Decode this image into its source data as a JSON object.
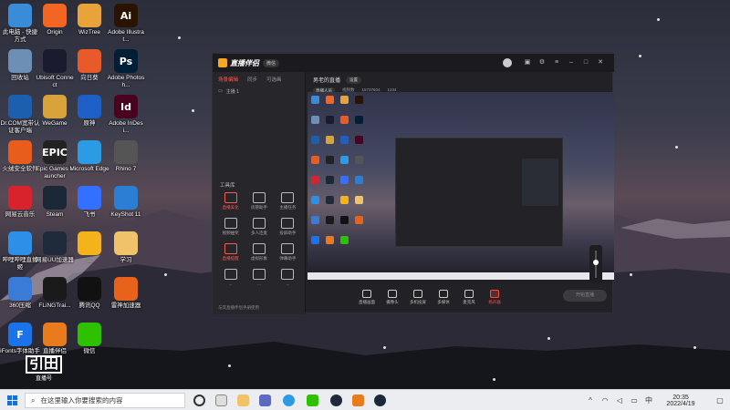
{
  "desktop": {
    "icons": [
      {
        "label": "此电脑 - 快捷方式",
        "color": "#3a8bd8",
        "icon": "computer-icon"
      },
      {
        "label": "Origin",
        "color": "#f26522",
        "icon": "origin-icon"
      },
      {
        "label": "WizTree",
        "color": "#e8a33b",
        "icon": "wiztree-icon"
      },
      {
        "label": "Adobe Illustrat...",
        "color": "#2a1300",
        "icon": "illustrator-icon",
        "glyph": "Ai"
      },
      {
        "label": "回收站",
        "color": "#6e8fb5",
        "icon": "recycle-bin-icon"
      },
      {
        "label": "Ubisoft Connect",
        "color": "#1b1b2f",
        "icon": "ubisoft-icon"
      },
      {
        "label": "向日葵",
        "color": "#e85a2a",
        "icon": "sunlogin-icon"
      },
      {
        "label": "Adobe Photosh...",
        "color": "#001e36",
        "icon": "photoshop-icon",
        "glyph": "Ps"
      },
      {
        "label": "Dr.COM宽带认证客户端",
        "color": "#1b5fae",
        "icon": "drcom-icon"
      },
      {
        "label": "WeGame",
        "color": "#d9a33b",
        "icon": "wegame-icon"
      },
      {
        "label": "原神",
        "color": "#1d5fc6",
        "icon": "genshin-icon"
      },
      {
        "label": "Adobe InDesi...",
        "color": "#49021f",
        "icon": "indesign-icon",
        "glyph": "Id"
      },
      {
        "label": "火绒安全软件",
        "color": "#e85c1c",
        "icon": "huorong-icon"
      },
      {
        "label": "Epic Games Launcher",
        "color": "#222",
        "icon": "epic-icon",
        "glyph": "EPIC"
      },
      {
        "label": "Microsoft Edge",
        "color": "#2b9be3",
        "icon": "edge-icon"
      },
      {
        "label": "Rhino 7",
        "color": "#555",
        "icon": "rhino-icon"
      },
      {
        "label": "网易云音乐",
        "color": "#d9232c",
        "icon": "netease-music-icon"
      },
      {
        "label": "Steam",
        "color": "#1b2838",
        "icon": "steam-icon"
      },
      {
        "label": "飞书",
        "color": "#3370ff",
        "icon": "feishu-icon"
      },
      {
        "label": "KeyShot 11",
        "color": "#2a7fd4",
        "icon": "keyshot-icon"
      },
      {
        "label": "哔哩哔哩直播姬",
        "color": "#2d8fe8",
        "icon": "bilibili-icon"
      },
      {
        "label": "网易UU加速器",
        "color": "#1f2b3a",
        "icon": "uu-icon"
      },
      {
        "label": "...",
        "color": "#f5b31b",
        "icon": "game-icon"
      },
      {
        "label": "学习",
        "color": "#f0c36a",
        "icon": "folder-icon"
      },
      {
        "label": "360压缩",
        "color": "#3b7bd8",
        "icon": "zip-icon"
      },
      {
        "label": "FLiNGTrai...",
        "color": "#1a1a1a",
        "icon": "fling-icon"
      },
      {
        "label": "腾讯QQ",
        "color": "#111",
        "icon": "qq-icon"
      },
      {
        "label": "雷神加速器",
        "color": "#e8621c",
        "icon": "leishen-icon"
      },
      {
        "label": "iFonts字体助手",
        "color": "#1a73e8",
        "icon": "ifonts-icon",
        "glyph": "F"
      },
      {
        "label": "直播伴侣",
        "color": "#e87c1c",
        "icon": "live-companion-icon"
      },
      {
        "label": "微信",
        "color": "#2dc100",
        "icon": "wechat-icon"
      }
    ]
  },
  "app": {
    "logo": "直播伴侣",
    "badge": "微信",
    "sidebar": {
      "tabs": [
        "场景编辑",
        "同步",
        "可选画"
      ],
      "scene": "主播 1",
      "tools_title": "工具库",
      "tools": [
        {
          "label": "直播美化",
          "active": true
        },
        {
          "label": "房管助手",
          "active": false
        },
        {
          "label": "主播任务",
          "active": false
        },
        {
          "label": "视频抽奖",
          "active": false
        },
        {
          "label": "多人连麦",
          "active": false
        },
        {
          "label": "投屏助手",
          "active": false
        },
        {
          "label": "直播提醒",
          "active": true
        },
        {
          "label": "虚拟形象",
          "active": false
        },
        {
          "label": "弹幕助手",
          "active": false
        },
        {
          "label": "...",
          "active": false
        },
        {
          "label": "...",
          "active": false
        },
        {
          "label": "...",
          "active": false
        }
      ],
      "footer": "与其直播伴侣手册使用"
    },
    "main": {
      "title": "男老的直播",
      "chip": "设置",
      "sub": [
        "直播人员",
        "视频数",
        "15737604",
        "1234"
      ]
    },
    "bottom_buttons": [
      {
        "label": "直播画面",
        "active": false
      },
      {
        "label": "摄像头",
        "active": false
      },
      {
        "label": "多机投屏",
        "active": false
      },
      {
        "label": "多媒体",
        "active": false
      },
      {
        "label": "麦克风",
        "active": false
      },
      {
        "label": "扬声器",
        "active": true
      }
    ],
    "start_live": "开始直播"
  },
  "watermark": {
    "big": "引田",
    "small": "直播号"
  },
  "taskbar": {
    "search_placeholder": "在这里输入你要搜索的内容",
    "time": "20:35",
    "date": "2022/4/19"
  }
}
